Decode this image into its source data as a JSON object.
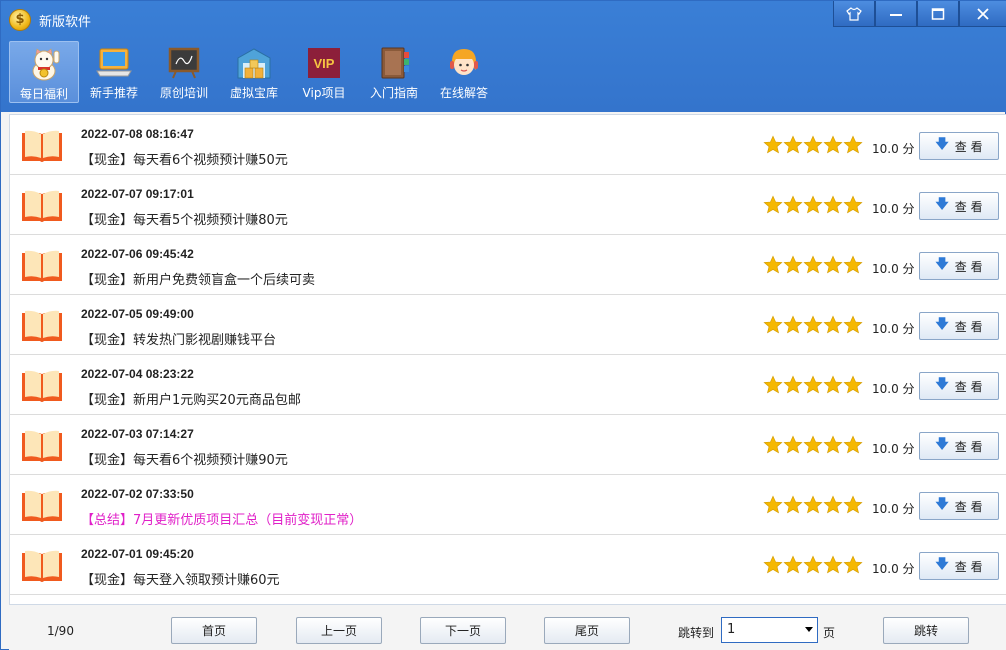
{
  "window": {
    "title": "新版软件",
    "controls": [
      "skin",
      "minimize",
      "maximize",
      "close"
    ]
  },
  "nav": [
    {
      "label": "每日福利",
      "icon": "lucky-cat-icon",
      "active": true
    },
    {
      "label": "新手推荐",
      "icon": "laptop-icon",
      "active": false
    },
    {
      "label": "原创培训",
      "icon": "blackboard-icon",
      "active": false
    },
    {
      "label": "虚拟宝库",
      "icon": "warehouse-icon",
      "active": false
    },
    {
      "label": "Vip项目",
      "icon": "vip-icon",
      "active": false
    },
    {
      "label": "入门指南",
      "icon": "guide-book-icon",
      "active": false
    },
    {
      "label": "在线解答",
      "icon": "support-agent-icon",
      "active": false
    }
  ],
  "list": {
    "rating_max": 5,
    "items": [
      {
        "date": "2022-07-08 08:16:47",
        "title": "【现金】每天看6个视频预计赚50元",
        "stars": 5,
        "score": "10.0 分",
        "button": "查 看",
        "highlight": false
      },
      {
        "date": "2022-07-07 09:17:01",
        "title": "【现金】每天看5个视频预计赚80元",
        "stars": 5,
        "score": "10.0 分",
        "button": "查 看",
        "highlight": false
      },
      {
        "date": "2022-07-06 09:45:42",
        "title": "【现金】新用户免费领盲盒一个后续可卖",
        "stars": 5,
        "score": "10.0 分",
        "button": "查 看",
        "highlight": false
      },
      {
        "date": "2022-07-05 09:49:00",
        "title": "【现金】转发热门影视剧赚钱平台",
        "stars": 5,
        "score": "10.0 分",
        "button": "查 看",
        "highlight": false
      },
      {
        "date": "2022-07-04 08:23:22",
        "title": "【现金】新用户1元购买20元商品包邮",
        "stars": 5,
        "score": "10.0 分",
        "button": "查 看",
        "highlight": false
      },
      {
        "date": "2022-07-03 07:14:27",
        "title": "【现金】每天看6个视频预计赚90元",
        "stars": 5,
        "score": "10.0 分",
        "button": "查 看",
        "highlight": false
      },
      {
        "date": "2022-07-02 07:33:50",
        "title": "【总结】7月更新优质项目汇总（目前变现正常）",
        "stars": 5,
        "score": "10.0 分",
        "button": "查 看",
        "highlight": true
      },
      {
        "date": "2022-07-01 09:45:20",
        "title": "【现金】每天登入领取预计赚60元",
        "stars": 5,
        "score": "10.0 分",
        "button": "查 看",
        "highlight": false
      }
    ]
  },
  "colors": {
    "titlebar": "#3474cc",
    "highlight_text": "#e020c8",
    "star": "#f5b800",
    "book": "#f05a1e"
  },
  "pagination": {
    "page_info": "1/90",
    "first": "首页",
    "prev": "上一页",
    "next": "下一页",
    "last": "尾页",
    "jump_label": "跳转到",
    "jump_value": "1",
    "page_unit": "页",
    "jump_button": "跳转"
  }
}
